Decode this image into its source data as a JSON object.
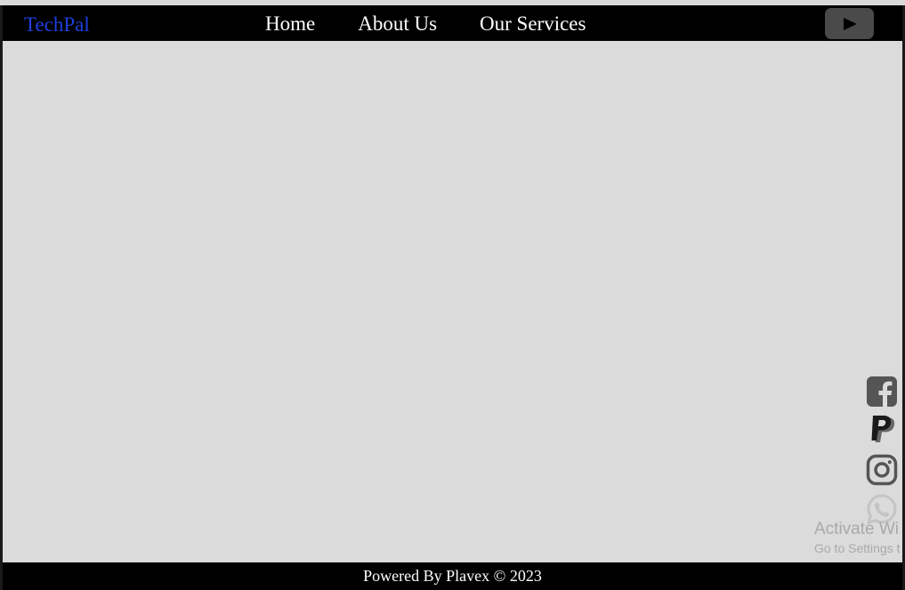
{
  "navbar": {
    "brand": "TechPal",
    "links": [
      {
        "label": "Home"
      },
      {
        "label": "About Us"
      },
      {
        "label": "Our Services"
      }
    ],
    "video_icon": "youtube-play-icon"
  },
  "social_icons": [
    "facebook-icon",
    "paypal-icon",
    "instagram-icon",
    "whatsapp-icon"
  ],
  "watermark": {
    "title": "Activate Wi",
    "subtitle": "Go to Settings t"
  },
  "footer": {
    "text": "Powered By Plavex © 2023"
  },
  "colors": {
    "navbar_bg": "#000000",
    "brand": "#1f3fe0",
    "body_bg": "#dbdbdb",
    "icon_gray": "#555555"
  }
}
